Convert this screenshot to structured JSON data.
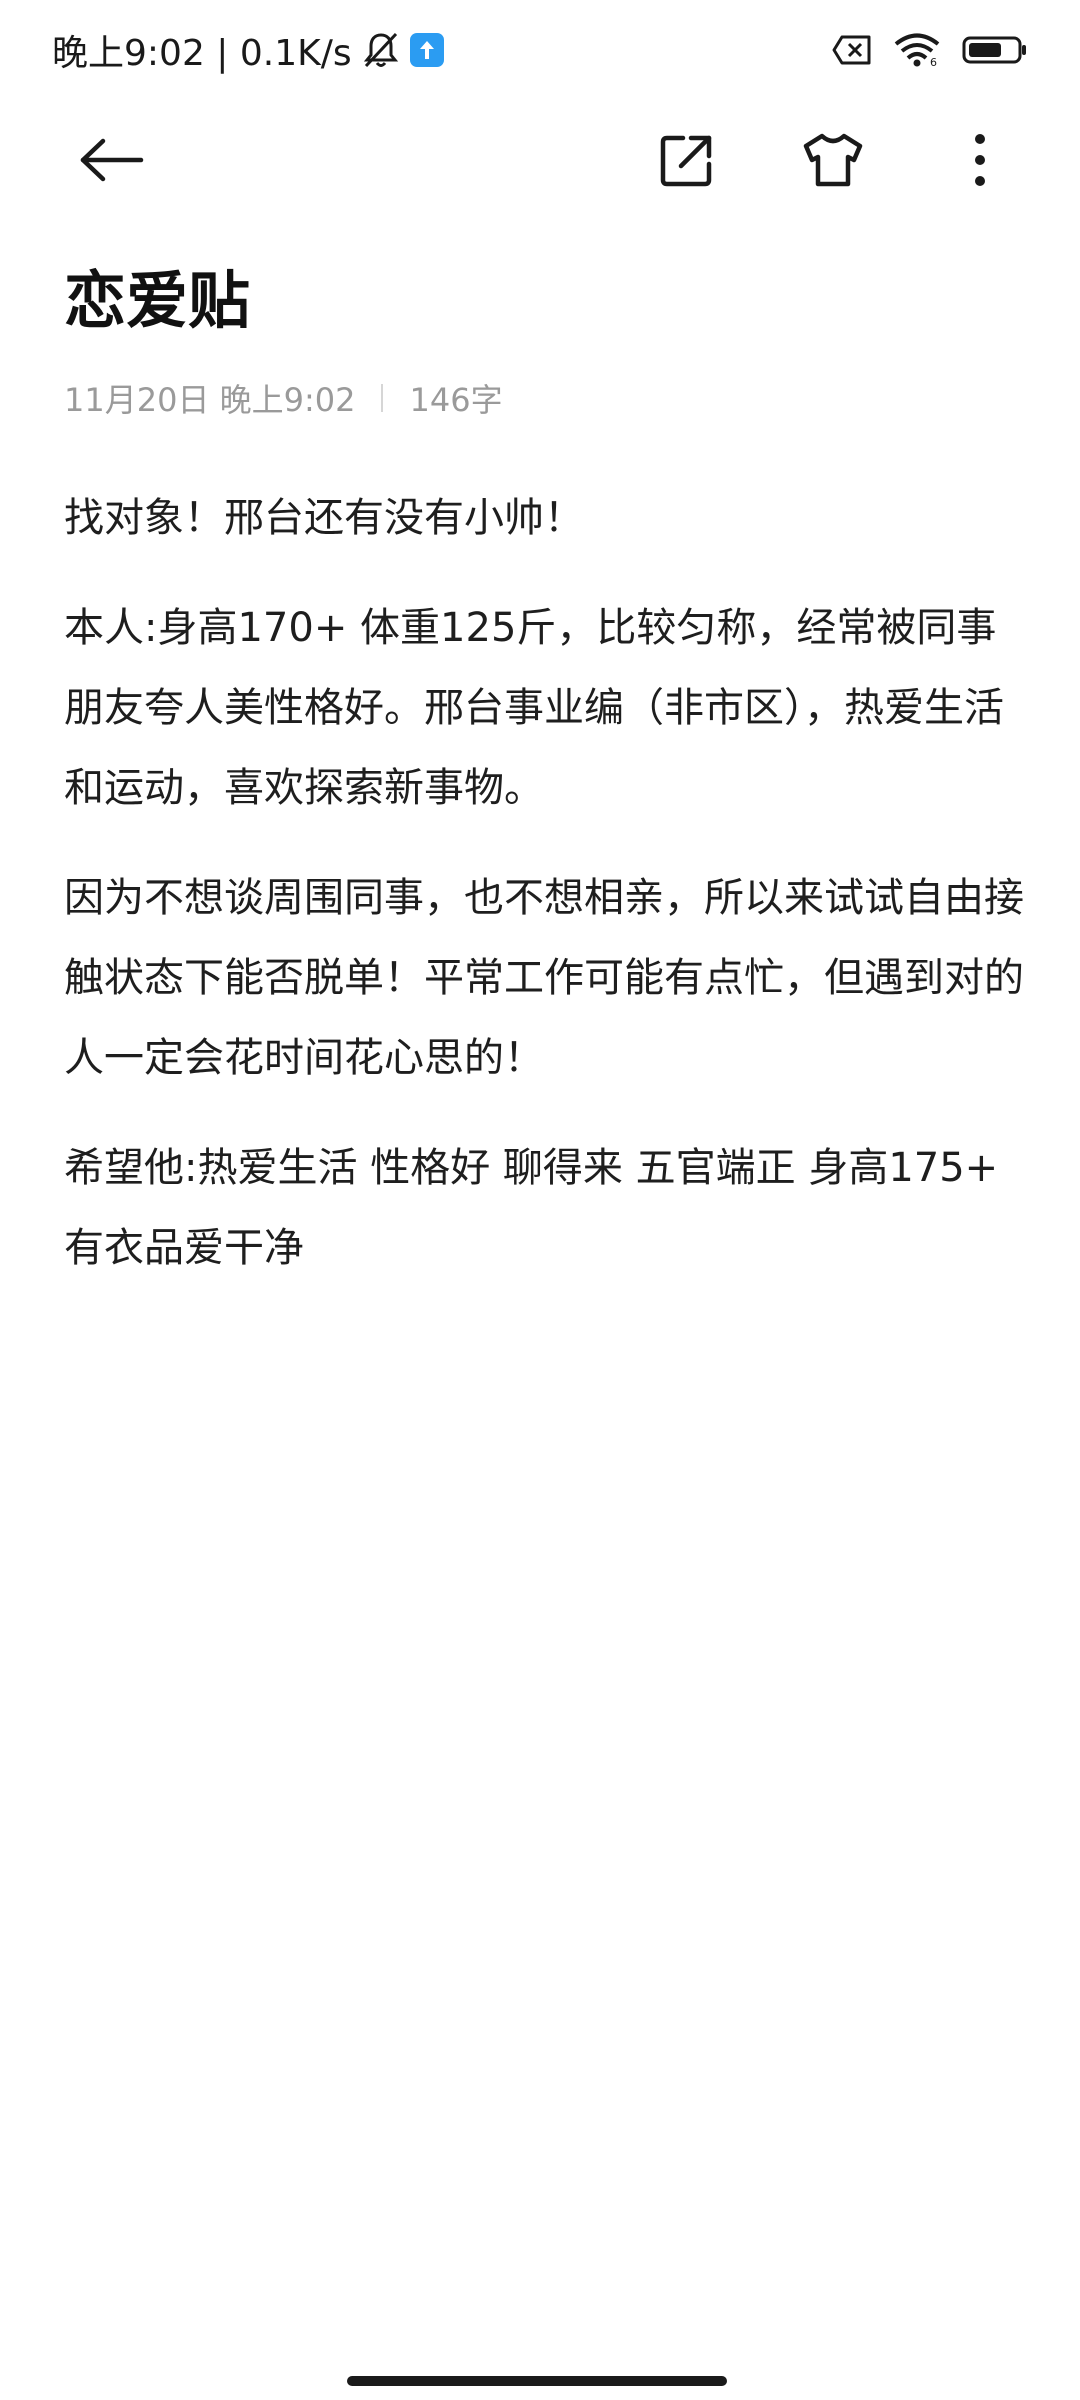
{
  "status_bar": {
    "time_speed": "晚上9:02 | 0.1K/s",
    "notification_badge_color": "#2b9cf2",
    "icons": [
      "bell-muted-icon",
      "upload-notification-icon",
      "no-sim-icon",
      "wifi-icon",
      "battery-icon"
    ]
  },
  "toolbar": {
    "icons": [
      "back-arrow-icon",
      "share-icon",
      "theme-shirt-icon",
      "more-icon"
    ]
  },
  "note": {
    "title": "恋爱贴",
    "date": "11月20日 晚上9:02",
    "word_count": "146字",
    "paragraphs": [
      "找对象！邢台还有没有小帅！",
      "本人:身高170+ 体重125斤，比较匀称，经常被同事朋友夸人美性格好。邢台事业编（非市区），热爱生活和运动，喜欢探索新事物。",
      "因为不想谈周围同事，也不想相亲，所以来试试自由接触状态下能否脱单！平常工作可能有点忙，但遇到对的人一定会花时间花心思的！",
      "希望他:热爱生活 性格好 聊得来 五官端正 身高175+  有衣品爱干净"
    ]
  }
}
